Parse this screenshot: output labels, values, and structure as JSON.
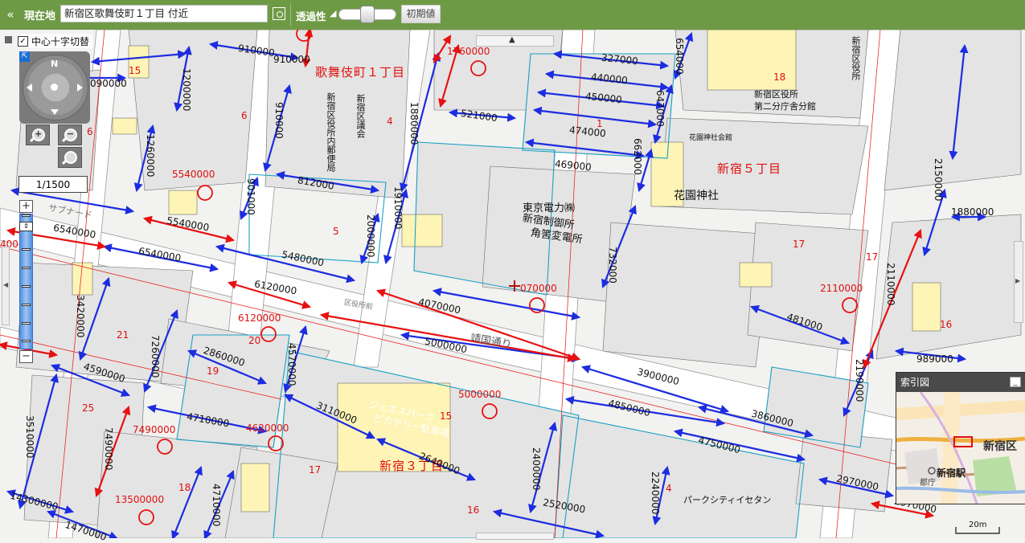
{
  "toolbar": {
    "collapse_icon": "«",
    "location_label": "現在地",
    "location_value": "新宿区歌舞伎町１丁目 付近",
    "opacity_label": "透過性",
    "opacity_level": 0.5,
    "reset_label": "初期値"
  },
  "controls": {
    "crosshair_toggle_label": "中心十字切替",
    "crosshair_checked": true,
    "compass_label": "N",
    "scale_value": "1/1500"
  },
  "index_map": {
    "title": "索引図",
    "minimize_icon": "_",
    "ward_label": "新宿区",
    "station_label": "新宿駅",
    "small_label": "都庁"
  },
  "scalebar": {
    "label": "20m"
  },
  "map": {
    "area_names": [
      "歌舞伎町１丁目",
      "新宿５丁目",
      "新宿３丁目"
    ],
    "block_numbers": [
      "15",
      "6",
      "6",
      "4",
      "1",
      "18",
      "5",
      "17",
      "17",
      "16",
      "21",
      "20",
      "19",
      "25",
      "18",
      "17",
      "15",
      "16",
      "4"
    ],
    "values_blue": [
      "910000",
      "910000",
      "1200000",
      "090000",
      "327000",
      "440000",
      "450000",
      "474000",
      "469000",
      "521000",
      "910000",
      "1260000",
      "812000",
      "901000",
      "1880000",
      "1910000",
      "2000000",
      "654000",
      "647000",
      "662000",
      "732000",
      "5540000",
      "6540000",
      "5480000",
      "4070000",
      "5000000",
      "3420000",
      "4590000",
      "7260000",
      "2860000",
      "4570000",
      "3110000",
      "4710000",
      "3510000",
      "7490000",
      "4710000",
      "2640000",
      "2400000",
      "2520000",
      "2240000",
      "3900000",
      "4850000",
      "3860000",
      "4750000",
      "2970000",
      "2970000",
      "14300000",
      "1470000",
      "481000",
      "2190000",
      "2150000",
      "1880000",
      "989000"
    ],
    "values_red": [
      "1760000",
      "5540000",
      "6120000",
      "6120000",
      "7490000",
      "4620000",
      "13500000",
      "5000000",
      "2110000",
      "2110000",
      "400",
      "070000",
      "6540000"
    ],
    "facility_labels": [
      "東京電力㈱",
      "新宿制御所",
      "角筈変電所",
      "花園神社",
      "花園神社会館",
      "新宿区役所",
      "第二分庁舎分館",
      "新宿区役所",
      "新宿区議会",
      "新宿区役所内郵便局",
      "ジェエスパーク",
      "ピカデリー駐車場",
      "パークシティイセタン",
      "サブナード",
      "靖国通り",
      "区役所前"
    ]
  }
}
